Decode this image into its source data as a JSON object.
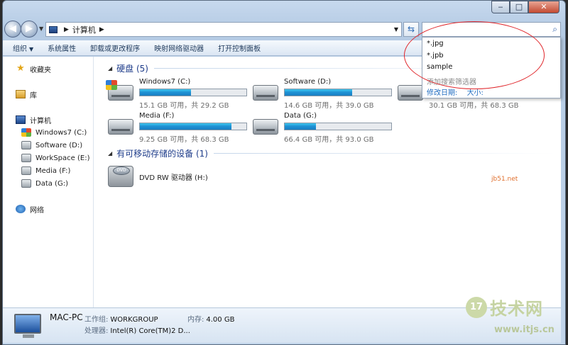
{
  "address": {
    "crumb": "计算机"
  },
  "toolbar": {
    "items": [
      "组织",
      "系统属性",
      "卸载或更改程序",
      "映射网络驱动器",
      "打开控制面板"
    ]
  },
  "nav": {
    "favorites": "收藏夹",
    "libraries": "库",
    "computer": "计算机",
    "drives": [
      "Windows7 (C:)",
      "Software (D:)",
      "WorkSpace (E:)",
      "Media (F:)",
      "Data (G:)"
    ],
    "network": "网络"
  },
  "main": {
    "hdd_group": "硬盘 (5)",
    "hdd": [
      {
        "name": "Windows7 (C:)",
        "free": "15.1 GB 可用，共 29.2 GB",
        "used_fraction": 0.48,
        "icon": "windows-drive-icon"
      },
      {
        "name": "Software (D:)",
        "free": "14.6 GB 可用，共 39.0 GB",
        "used_fraction": 0.63,
        "icon": "hard-drive-icon"
      },
      {
        "name": "",
        "free": "30.1 GB 可用，共 68.3 GB",
        "used_fraction": 0.56,
        "icon": "hard-drive-icon"
      },
      {
        "name": "Media (F:)",
        "free": "9.25 GB 可用，共 68.3 GB",
        "used_fraction": 0.86,
        "icon": "hard-drive-icon"
      },
      {
        "name": "Data (G:)",
        "free": "66.4 GB 可用，共 93.0 GB",
        "used_fraction": 0.29,
        "icon": "hard-drive-icon"
      }
    ],
    "removable_group": "有可移动存储的设备 (1)",
    "dvd": {
      "name": "DVD RW 驱动器 (H:)",
      "disc_label": "DVD"
    }
  },
  "search_dropdown": {
    "items": [
      "*.jpg",
      "*.jpb",
      "sample"
    ],
    "filter_label": "添加搜索筛选器",
    "links": [
      "修改日期:",
      "大小:"
    ]
  },
  "details": {
    "name": "MAC-PC",
    "workgroup_label": "工作组:",
    "workgroup": "WORKGROUP",
    "memory_label": "内存:",
    "memory": "4.00 GB",
    "cpu_label": "处理器:",
    "cpu": "Intel(R) Core(TM)2 D..."
  },
  "watermark": {
    "badge": "17",
    "brand": "技术网",
    "url": "www.itjs.cn",
    "url2": "jb51.net"
  },
  "colors": {
    "accent": "#1e3c8a",
    "bar": "#1d8fd3",
    "annotation": "#e0262b"
  }
}
